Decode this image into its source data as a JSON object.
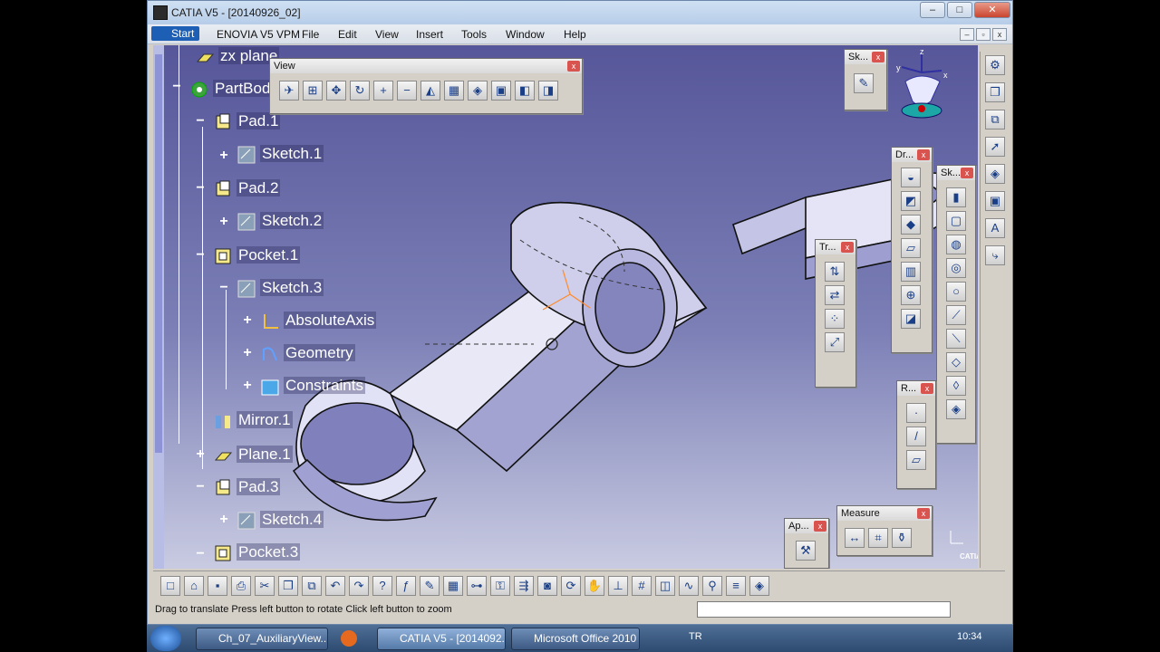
{
  "window": {
    "title": "CATIA V5 - [20140926_02]",
    "controls": {
      "minimize": "‒",
      "maximize": "□",
      "close": "✕"
    },
    "mdi_controls": {
      "minimize": "‒",
      "restore": "▫",
      "close": "x"
    }
  },
  "menubar": {
    "start": "Start",
    "items": [
      "ENOVIA V5 VPM",
      "File",
      "Edit",
      "View",
      "Insert",
      "Tools",
      "Window",
      "Help"
    ]
  },
  "tree": {
    "nodes": [
      {
        "label": "zx plane",
        "icon": "plane-icon"
      },
      {
        "label": "PartBody",
        "icon": "partbody-icon"
      },
      {
        "label": "Pad.1",
        "icon": "pad-icon"
      },
      {
        "label": "Sketch.1",
        "icon": "sketch-icon"
      },
      {
        "label": "Pad.2",
        "icon": "pad-icon"
      },
      {
        "label": "Sketch.2",
        "icon": "sketch-icon"
      },
      {
        "label": "Pocket.1",
        "icon": "pocket-icon"
      },
      {
        "label": "Sketch.3",
        "icon": "sketch-icon"
      },
      {
        "label": "AbsoluteAxis",
        "icon": "axis-icon"
      },
      {
        "label": "Geometry",
        "icon": "geometry-icon"
      },
      {
        "label": "Constraints",
        "icon": "constraints-icon"
      },
      {
        "label": "Mirror.1",
        "icon": "mirror-icon"
      },
      {
        "label": "Plane.1",
        "icon": "plane-icon"
      },
      {
        "label": "Pad.3",
        "icon": "pad-icon"
      },
      {
        "label": "Sketch.4",
        "icon": "sketch-icon"
      },
      {
        "label": "Pocket.3",
        "icon": "pocket-icon"
      }
    ]
  },
  "toolbars": {
    "view": "View",
    "sketcher": "Sk...",
    "dress_up": "Dr...",
    "sketch_based": "Sk...",
    "transformation": "Tr...",
    "reference": "R...",
    "apply_material": "Ap...",
    "measure": "Measure",
    "close_glyph": "x"
  },
  "status": {
    "message": "Drag to translate  Press left button to rotate  Click left button to zoom"
  },
  "taskbar": {
    "buttons": [
      "Ch_07_AuxiliaryView...",
      "CATIA V5 - [2014092...",
      "Microsoft Office 2010"
    ],
    "lang": "TR",
    "clock": "10:34"
  },
  "compass_axes": {
    "x": "x",
    "y": "y",
    "z": "z"
  },
  "brand": "CATIA",
  "colors": {
    "accent": "#1e5fb6",
    "viewport_top": "#56569a",
    "viewport_bottom": "#c9cbe2"
  }
}
